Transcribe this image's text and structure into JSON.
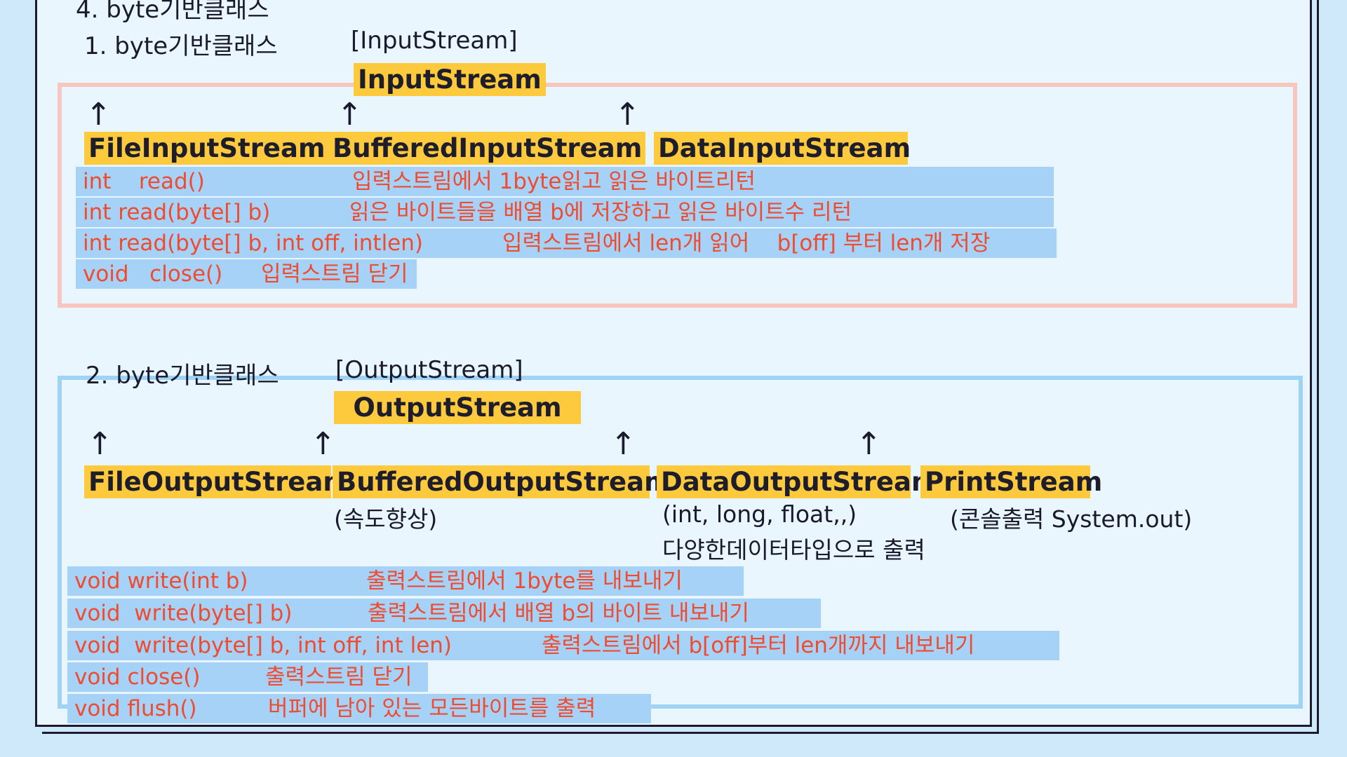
{
  "section_title": "4. byte기반클래스",
  "input": {
    "heading": "1. byte기반클래스",
    "heading_tag": "[InputStream]",
    "parent": "InputStream",
    "arrow": "↑",
    "children": [
      "FileInputStream",
      "BufferedInputStream",
      "DataInputStream"
    ],
    "methods": [
      {
        "sig": "int    read()",
        "desc": "입력스트림에서 1byte읽고 읽은 바이트리턴"
      },
      {
        "sig": "int read(byte[] b)",
        "desc": "읽은 바이트들을 배열 b에 저장하고 읽은 바이트수 리턴"
      },
      {
        "sig": "int read(byte[] b, int off, intlen)",
        "desc": "입력스트림에서 len개 읽어    b[off] 부터 len개 저장"
      },
      {
        "sig": "void   close()",
        "desc": "입력스트림 닫기"
      }
    ]
  },
  "output": {
    "heading": "2. byte기반클래스",
    "heading_tag": "[OutputStream]",
    "parent": "OutputStream",
    "arrow": "↑",
    "children": [
      "FileOutputStream",
      "BufferedOutputStream",
      "DataOutputStream",
      "PrintStream"
    ],
    "notes": {
      "buffered": "(속도향상)",
      "data_line1": "(int, long, float,,)",
      "data_line2": "다양한데이터타입으로 출력",
      "print": "(콘솔출력  System.out)"
    },
    "methods": [
      {
        "sig": "void write(int b)",
        "desc": "출력스트림에서 1byte를 내보내기"
      },
      {
        "sig": "void  write(byte[] b)",
        "desc": "출력스트림에서 배열 b의 바이트 내보내기"
      },
      {
        "sig": "void  write(byte[] b, int off, int len)",
        "desc": "출력스트림에서 b[off]부터 len개까지 내보내기"
      },
      {
        "sig": "void close()",
        "desc": "출력스트림 닫기"
      },
      {
        "sig": "void flush()",
        "desc": "버퍼에 남아 있는 모든바이트를 출력"
      }
    ]
  },
  "colors": {
    "highlight": "#fdc93d",
    "method_bg": "#a6d2f8",
    "method_text": "#f04b2f",
    "input_border": "#f7c6bc",
    "output_border": "#9fd3f6"
  }
}
